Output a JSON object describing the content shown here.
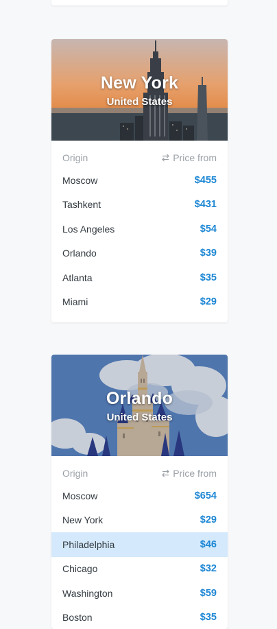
{
  "cards": [
    {
      "city": "New York",
      "country": "United States",
      "header_origin": "Origin",
      "header_price": "Price from",
      "rows": [
        {
          "origin": "Moscow",
          "price": "$455"
        },
        {
          "origin": "Tashkent",
          "price": "$431"
        },
        {
          "origin": "Los Angeles",
          "price": "$54"
        },
        {
          "origin": "Orlando",
          "price": "$39"
        },
        {
          "origin": "Atlanta",
          "price": "$35"
        },
        {
          "origin": "Miami",
          "price": "$29"
        }
      ]
    },
    {
      "city": "Orlando",
      "country": "United States",
      "header_origin": "Origin",
      "header_price": "Price from",
      "rows": [
        {
          "origin": "Moscow",
          "price": "$654"
        },
        {
          "origin": "New York",
          "price": "$29"
        },
        {
          "origin": "Philadelphia",
          "price": "$46",
          "highlighted": true
        },
        {
          "origin": "Chicago",
          "price": "$32"
        },
        {
          "origin": "Washington",
          "price": "$59"
        },
        {
          "origin": "Boston",
          "price": "$35"
        }
      ]
    }
  ],
  "colors": {
    "price": "#1d87d4",
    "highlight_row": "#d4e9fb",
    "muted_text": "#9aa0a6",
    "body_text": "#333a40"
  },
  "icons": {
    "price_header_icon": "swap-arrows-icon"
  }
}
